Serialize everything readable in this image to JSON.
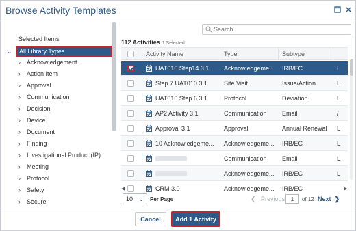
{
  "dialog": {
    "title": "Browse Activity Templates"
  },
  "icons": {
    "maximize": "maximize-icon",
    "close": "close-icon"
  },
  "tree": {
    "selected_items_label": "Selected Items",
    "root_label": "All Library Types",
    "items": [
      {
        "label": "Acknowledgement"
      },
      {
        "label": "Action Item"
      },
      {
        "label": "Approval"
      },
      {
        "label": "Communication"
      },
      {
        "label": "Decision"
      },
      {
        "label": "Device"
      },
      {
        "label": "Document"
      },
      {
        "label": "Finding"
      },
      {
        "label": "Investigational Product (IP)"
      },
      {
        "label": "Meeting"
      },
      {
        "label": "Protocol"
      },
      {
        "label": "Safety"
      },
      {
        "label": "Secure"
      }
    ]
  },
  "search": {
    "placeholder": "Search"
  },
  "list": {
    "count": "112 Activities",
    "selected": "1 Selected",
    "columns": [
      "Activity Name",
      "Type",
      "Subtype"
    ],
    "rows": [
      {
        "name": "UAT010 Step14 3.1",
        "type": "Acknowledgeme...",
        "subtype": "IRB/EC",
        "extra": "I"
      },
      {
        "name": "Step 7 UAT010 3.1",
        "type": "Site Visit",
        "subtype": "Issue/Action",
        "extra": "L"
      },
      {
        "name": "UAT010 Step 6 3.1",
        "type": "Protocol",
        "subtype": "Deviation",
        "extra": "L"
      },
      {
        "name": "AP2 Activity 3.1",
        "type": "Communication",
        "subtype": "Email",
        "extra": "/"
      },
      {
        "name": "Approval 3.1",
        "type": "Approval",
        "subtype": "Annual Renewal",
        "extra": "L"
      },
      {
        "name": "10 Acknowledgeme...",
        "type": "Acknowledgeme...",
        "subtype": "IRB/EC",
        "extra": "L"
      },
      {
        "name": "",
        "type": "Communication",
        "subtype": "Email",
        "extra": "L"
      },
      {
        "name": "",
        "type": "Acknowledgeme...",
        "subtype": "IRB/EC",
        "extra": "L"
      },
      {
        "name": "CRM 3.0",
        "type": "Acknowledgeme...",
        "subtype": "IRB/EC",
        "extra": ""
      }
    ]
  },
  "pager": {
    "page_size": "10",
    "per_page_label": "Per Page",
    "previous": "Previous",
    "current_page": "1",
    "of_label": "of 12",
    "next": "Next"
  },
  "footer": {
    "cancel": "Cancel",
    "add": "Add 1 Activity"
  },
  "colors": {
    "accent": "#2d5a88",
    "highlight_border": "#c0282d"
  }
}
